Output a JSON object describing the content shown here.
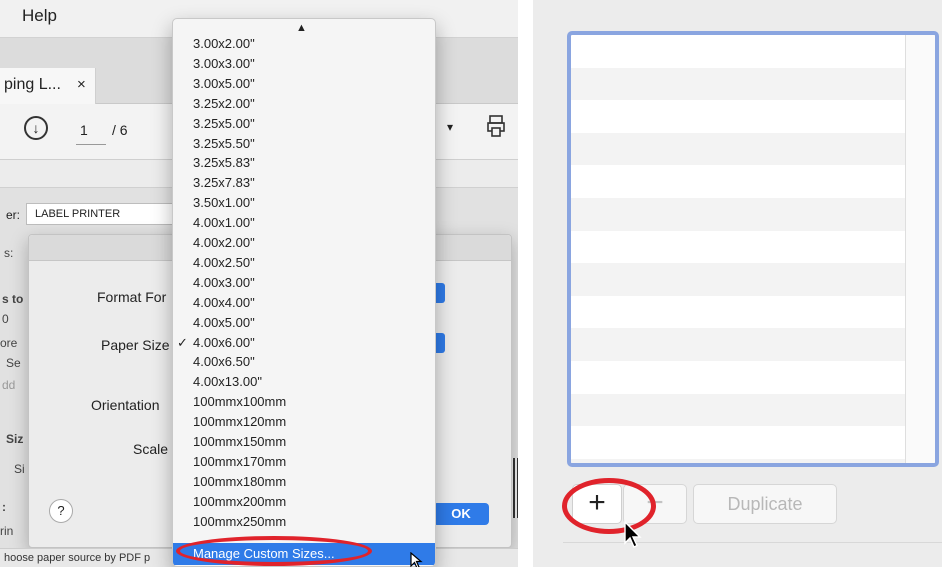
{
  "left_panel": {
    "menubar": {
      "help": "Help"
    },
    "tab": {
      "title": "ping L...",
      "close": "×"
    },
    "toolbar": {
      "page_current": "1",
      "page_total": "/ 6"
    },
    "form": {
      "printer_label": "er:",
      "printer_value": "LABEL PRINTER",
      "bg_texts": [
        "s:",
        "s to",
        "0",
        "ore",
        "Se",
        "dd",
        "Siz",
        "Si",
        ":",
        "rin"
      ]
    },
    "dialog": {
      "format_for": "Format For",
      "paper_size": "Paper Size",
      "orientation": "Orientation",
      "scale": "Scale",
      "help": "?",
      "ok": "OK"
    },
    "status_text": "hoose paper source by PDF p",
    "menu": {
      "scroll_up": "▲",
      "items": [
        {
          "label": "3.00x2.00\"",
          "checked": false
        },
        {
          "label": "3.00x3.00\"",
          "checked": false
        },
        {
          "label": "3.00x5.00\"",
          "checked": false
        },
        {
          "label": "3.25x2.00\"",
          "checked": false
        },
        {
          "label": "3.25x5.00\"",
          "checked": false
        },
        {
          "label": "3.25x5.50\"",
          "checked": false
        },
        {
          "label": "3.25x5.83\"",
          "checked": false
        },
        {
          "label": "3.25x7.83\"",
          "checked": false
        },
        {
          "label": "3.50x1.00\"",
          "checked": false
        },
        {
          "label": "4.00x1.00\"",
          "checked": false
        },
        {
          "label": "4.00x2.00\"",
          "checked": false
        },
        {
          "label": "4.00x2.50\"",
          "checked": false
        },
        {
          "label": "4.00x3.00\"",
          "checked": false
        },
        {
          "label": "4.00x4.00\"",
          "checked": false
        },
        {
          "label": "4.00x5.00\"",
          "checked": false
        },
        {
          "label": "4.00x6.00\"",
          "checked": true
        },
        {
          "label": "4.00x6.50\"",
          "checked": false
        },
        {
          "label": "4.00x13.00\"",
          "checked": false
        },
        {
          "label": "100mmx100mm",
          "checked": false
        },
        {
          "label": "100mmx120mm",
          "checked": false
        },
        {
          "label": "100mmx150mm",
          "checked": false
        },
        {
          "label": "100mmx170mm",
          "checked": false
        },
        {
          "label": "100mmx180mm",
          "checked": false
        },
        {
          "label": "100mmx200mm",
          "checked": false
        },
        {
          "label": "100mmx250mm",
          "checked": false
        }
      ],
      "check_glyph": "✓",
      "manage": "Manage Custom Sizes..."
    }
  },
  "right_panel": {
    "add_button": "+",
    "remove_button": "−",
    "duplicate_button": "Duplicate"
  },
  "colors": {
    "highlight_ring": "#e0232b",
    "accent_blue": "#2f7be8",
    "list_focus": "#8aa5e0"
  }
}
